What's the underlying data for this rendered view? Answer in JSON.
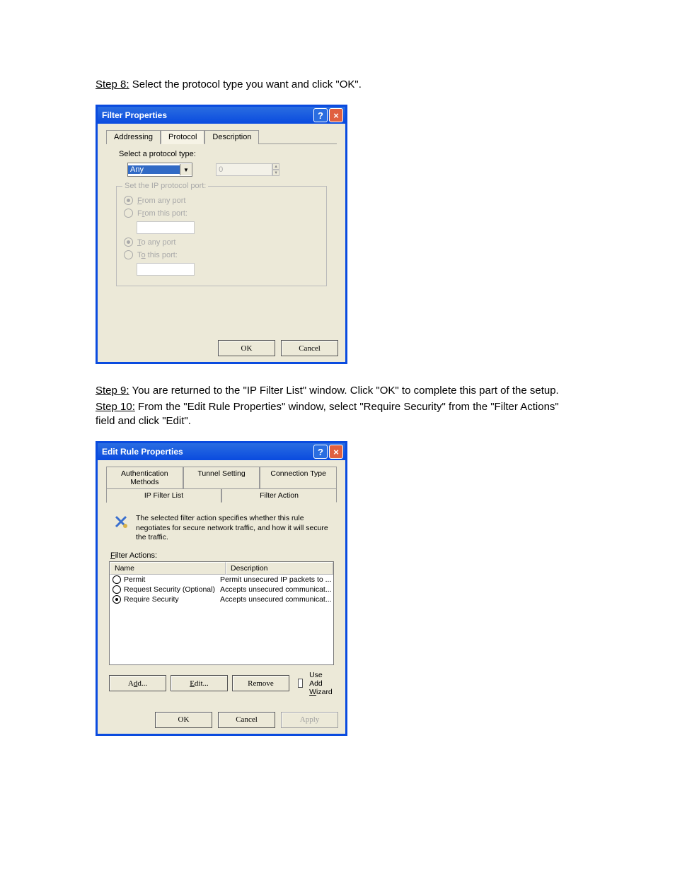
{
  "doc": {
    "step8_label": "Step 8:",
    "step8_text": " Select the protocol type you want and click \"OK\".",
    "step9_label": "Step 9:",
    "step9_text": " You are returned to the \"IP Filter List\" window. Click \"OK\" to complete this part of the setup.",
    "step10_label": "Step 10:",
    "step10_text": " From the \"Edit Rule Properties\" window, select \"Require Security\" from the \"Filter Actions\" field and click \"Edit\"."
  },
  "dlg1": {
    "title": "Filter Properties",
    "tabs": {
      "t1": "Addressing",
      "t2": "Protocol",
      "t3": "Description"
    },
    "select_label": "Select a protocol type:",
    "proto_value": "Any",
    "spinner_value": "0",
    "group_legend": "Set the IP protocol port:",
    "r_from_any": "From any port",
    "r_from_this": "From this port:",
    "r_to_any": "To any port",
    "r_to_this": "To this port:",
    "ok": "OK",
    "cancel": "Cancel"
  },
  "dlg2": {
    "title": "Edit Rule Properties",
    "tabs_top": {
      "t1": "Authentication Methods",
      "t2": "Tunnel Setting",
      "t3": "Connection Type"
    },
    "tabs_bot": {
      "t1": "IP Filter List",
      "t2": "Filter Action"
    },
    "info": "The selected filter action specifies whether this rule negotiates for secure network traffic, and how it will secure the traffic.",
    "list_label_pre": "F",
    "list_label_rest": "ilter Actions:",
    "col_name": "Name",
    "col_desc": "Description",
    "rows": [
      {
        "name": "Permit",
        "desc": "Permit unsecured IP packets to ..."
      },
      {
        "name": "Request Security (Optional)",
        "desc": "Accepts unsecured communicat..."
      },
      {
        "name": "Require Security",
        "desc": "Accepts unsecured communicat..."
      }
    ],
    "add": "Add...",
    "edit": "Edit...",
    "remove": "Remove",
    "use_wiz_pre": "Use Add ",
    "use_wiz_u": "W",
    "use_wiz_post": "izard",
    "ok": "OK",
    "cancel": "Cancel",
    "apply": "Apply"
  }
}
